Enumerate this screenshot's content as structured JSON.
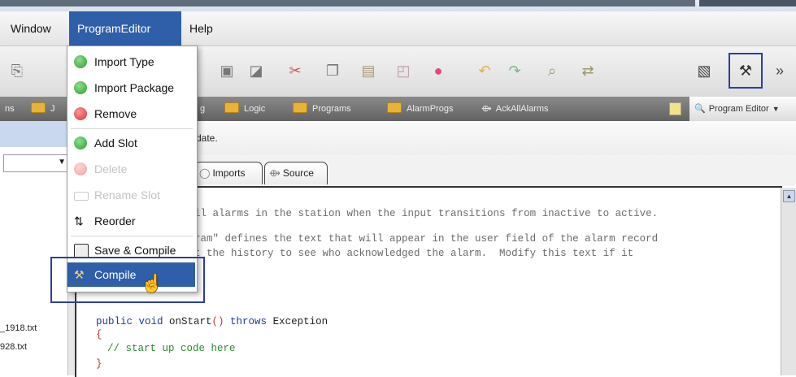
{
  "menubar": {
    "window": "Window",
    "program_editor": "ProgramEditor",
    "help": "Help"
  },
  "toolbar": {
    "overflow": "»",
    "icons": [
      "import-icon",
      "save-icon",
      "refresh-icon",
      "cut-icon",
      "copy-icon",
      "paste-icon",
      "paste-special-icon",
      "stop-icon",
      "undo-icon",
      "redo-icon",
      "find-icon",
      "replace-icon",
      "save-compile-icon",
      "compile-icon"
    ]
  },
  "nav": {
    "items": [
      "ns",
      "J",
      "g",
      "Logic",
      "Programs",
      "AlarmProgs",
      "AckAllAlarms"
    ],
    "program_editor": "Program Editor"
  },
  "left_pane": {
    "files": [
      "_1918.txt",
      "928.txt"
    ]
  },
  "main": {
    "status": "date."
  },
  "tabs": [
    {
      "label": "Imports",
      "icon": "imports-icon"
    },
    {
      "label": "Source",
      "icon": "source-icon"
    }
  ],
  "code": {
    "line1": "ll alarms in the station when the input transitions from inactive to active.",
    "line2": "ram\" defines the text that will appear in the user field of the alarm record",
    "line3": "t the history to see who acknowledged the alarm.  Modify this text if it",
    "sig_public": "public void ",
    "sig_name": "onStart",
    "sig_parens": "()",
    "sig_throws": " throws ",
    "sig_exc": "Exception",
    "brace_open": "{",
    "body_comment": "// start up code here",
    "brace_close": "}"
  },
  "dropdown": {
    "items": [
      {
        "label": "Import Type",
        "icon": "add-icon",
        "enabled": true
      },
      {
        "label": "Import Package",
        "icon": "add-icon",
        "enabled": true
      },
      {
        "label": "Remove",
        "icon": "remove-icon",
        "enabled": true
      },
      {
        "label": "Add Slot",
        "icon": "add-icon",
        "enabled": true
      },
      {
        "label": "Delete",
        "icon": "delete-icon",
        "enabled": false
      },
      {
        "label": "Rename Slot",
        "icon": "rename-icon",
        "enabled": false
      },
      {
        "label": "Reorder",
        "icon": "reorder-icon",
        "enabled": true
      },
      {
        "label": "Save & Compile",
        "icon": "save-compile-icon",
        "enabled": true
      },
      {
        "label": "Compile",
        "icon": "compile-icon",
        "enabled": true,
        "selected": true
      }
    ]
  },
  "colors": {
    "menu_active": "#2f5fa8",
    "highlight_box": "#2a3fa0",
    "keyword": "#1e3d91",
    "comment": "#2a8a2a"
  }
}
